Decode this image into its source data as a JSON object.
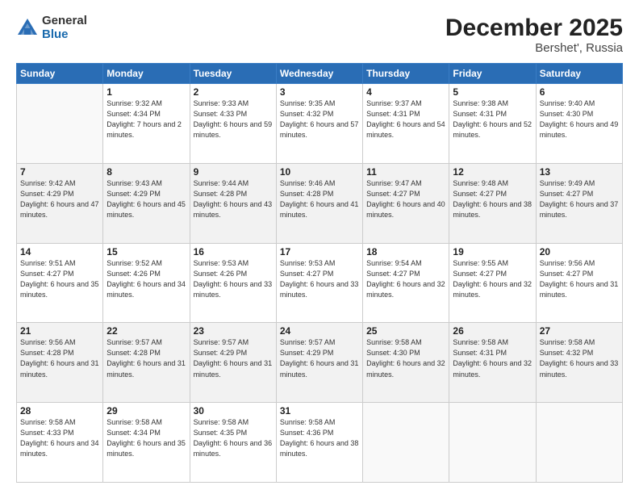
{
  "header": {
    "logo_general": "General",
    "logo_blue": "Blue",
    "month": "December 2025",
    "location": "Bershet', Russia"
  },
  "weekdays": [
    "Sunday",
    "Monday",
    "Tuesday",
    "Wednesday",
    "Thursday",
    "Friday",
    "Saturday"
  ],
  "weeks": [
    [
      {
        "day": "",
        "empty": true
      },
      {
        "day": "1",
        "sunrise": "Sunrise: 9:32 AM",
        "sunset": "Sunset: 4:34 PM",
        "daylight": "Daylight: 7 hours and 2 minutes."
      },
      {
        "day": "2",
        "sunrise": "Sunrise: 9:33 AM",
        "sunset": "Sunset: 4:33 PM",
        "daylight": "Daylight: 6 hours and 59 minutes."
      },
      {
        "day": "3",
        "sunrise": "Sunrise: 9:35 AM",
        "sunset": "Sunset: 4:32 PM",
        "daylight": "Daylight: 6 hours and 57 minutes."
      },
      {
        "day": "4",
        "sunrise": "Sunrise: 9:37 AM",
        "sunset": "Sunset: 4:31 PM",
        "daylight": "Daylight: 6 hours and 54 minutes."
      },
      {
        "day": "5",
        "sunrise": "Sunrise: 9:38 AM",
        "sunset": "Sunset: 4:31 PM",
        "daylight": "Daylight: 6 hours and 52 minutes."
      },
      {
        "day": "6",
        "sunrise": "Sunrise: 9:40 AM",
        "sunset": "Sunset: 4:30 PM",
        "daylight": "Daylight: 6 hours and 49 minutes."
      }
    ],
    [
      {
        "day": "7",
        "sunrise": "Sunrise: 9:42 AM",
        "sunset": "Sunset: 4:29 PM",
        "daylight": "Daylight: 6 hours and 47 minutes."
      },
      {
        "day": "8",
        "sunrise": "Sunrise: 9:43 AM",
        "sunset": "Sunset: 4:29 PM",
        "daylight": "Daylight: 6 hours and 45 minutes."
      },
      {
        "day": "9",
        "sunrise": "Sunrise: 9:44 AM",
        "sunset": "Sunset: 4:28 PM",
        "daylight": "Daylight: 6 hours and 43 minutes."
      },
      {
        "day": "10",
        "sunrise": "Sunrise: 9:46 AM",
        "sunset": "Sunset: 4:28 PM",
        "daylight": "Daylight: 6 hours and 41 minutes."
      },
      {
        "day": "11",
        "sunrise": "Sunrise: 9:47 AM",
        "sunset": "Sunset: 4:27 PM",
        "daylight": "Daylight: 6 hours and 40 minutes."
      },
      {
        "day": "12",
        "sunrise": "Sunrise: 9:48 AM",
        "sunset": "Sunset: 4:27 PM",
        "daylight": "Daylight: 6 hours and 38 minutes."
      },
      {
        "day": "13",
        "sunrise": "Sunrise: 9:49 AM",
        "sunset": "Sunset: 4:27 PM",
        "daylight": "Daylight: 6 hours and 37 minutes."
      }
    ],
    [
      {
        "day": "14",
        "sunrise": "Sunrise: 9:51 AM",
        "sunset": "Sunset: 4:27 PM",
        "daylight": "Daylight: 6 hours and 35 minutes."
      },
      {
        "day": "15",
        "sunrise": "Sunrise: 9:52 AM",
        "sunset": "Sunset: 4:26 PM",
        "daylight": "Daylight: 6 hours and 34 minutes."
      },
      {
        "day": "16",
        "sunrise": "Sunrise: 9:53 AM",
        "sunset": "Sunset: 4:26 PM",
        "daylight": "Daylight: 6 hours and 33 minutes."
      },
      {
        "day": "17",
        "sunrise": "Sunrise: 9:53 AM",
        "sunset": "Sunset: 4:27 PM",
        "daylight": "Daylight: 6 hours and 33 minutes."
      },
      {
        "day": "18",
        "sunrise": "Sunrise: 9:54 AM",
        "sunset": "Sunset: 4:27 PM",
        "daylight": "Daylight: 6 hours and 32 minutes."
      },
      {
        "day": "19",
        "sunrise": "Sunrise: 9:55 AM",
        "sunset": "Sunset: 4:27 PM",
        "daylight": "Daylight: 6 hours and 32 minutes."
      },
      {
        "day": "20",
        "sunrise": "Sunrise: 9:56 AM",
        "sunset": "Sunset: 4:27 PM",
        "daylight": "Daylight: 6 hours and 31 minutes."
      }
    ],
    [
      {
        "day": "21",
        "sunrise": "Sunrise: 9:56 AM",
        "sunset": "Sunset: 4:28 PM",
        "daylight": "Daylight: 6 hours and 31 minutes."
      },
      {
        "day": "22",
        "sunrise": "Sunrise: 9:57 AM",
        "sunset": "Sunset: 4:28 PM",
        "daylight": "Daylight: 6 hours and 31 minutes."
      },
      {
        "day": "23",
        "sunrise": "Sunrise: 9:57 AM",
        "sunset": "Sunset: 4:29 PM",
        "daylight": "Daylight: 6 hours and 31 minutes."
      },
      {
        "day": "24",
        "sunrise": "Sunrise: 9:57 AM",
        "sunset": "Sunset: 4:29 PM",
        "daylight": "Daylight: 6 hours and 31 minutes."
      },
      {
        "day": "25",
        "sunrise": "Sunrise: 9:58 AM",
        "sunset": "Sunset: 4:30 PM",
        "daylight": "Daylight: 6 hours and 32 minutes."
      },
      {
        "day": "26",
        "sunrise": "Sunrise: 9:58 AM",
        "sunset": "Sunset: 4:31 PM",
        "daylight": "Daylight: 6 hours and 32 minutes."
      },
      {
        "day": "27",
        "sunrise": "Sunrise: 9:58 AM",
        "sunset": "Sunset: 4:32 PM",
        "daylight": "Daylight: 6 hours and 33 minutes."
      }
    ],
    [
      {
        "day": "28",
        "sunrise": "Sunrise: 9:58 AM",
        "sunset": "Sunset: 4:33 PM",
        "daylight": "Daylight: 6 hours and 34 minutes."
      },
      {
        "day": "29",
        "sunrise": "Sunrise: 9:58 AM",
        "sunset": "Sunset: 4:34 PM",
        "daylight": "Daylight: 6 hours and 35 minutes."
      },
      {
        "day": "30",
        "sunrise": "Sunrise: 9:58 AM",
        "sunset": "Sunset: 4:35 PM",
        "daylight": "Daylight: 6 hours and 36 minutes."
      },
      {
        "day": "31",
        "sunrise": "Sunrise: 9:58 AM",
        "sunset": "Sunset: 4:36 PM",
        "daylight": "Daylight: 6 hours and 38 minutes."
      },
      {
        "day": "",
        "empty": true
      },
      {
        "day": "",
        "empty": true
      },
      {
        "day": "",
        "empty": true
      }
    ]
  ]
}
